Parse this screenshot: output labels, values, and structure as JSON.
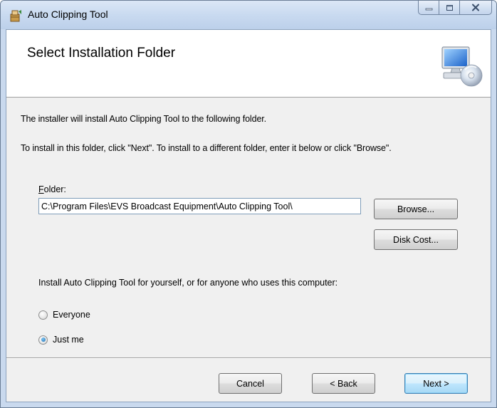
{
  "window": {
    "title": "Auto Clipping Tool"
  },
  "banner": {
    "title": "Select Installation Folder"
  },
  "body": {
    "line1": "The installer will install Auto Clipping Tool to the following folder.",
    "line2": "To install in this folder, click \"Next\". To install to a different folder, enter it below or click \"Browse\"."
  },
  "folder": {
    "label_accel": "F",
    "label_rest": "older:",
    "value": "C:\\Program Files\\EVS Broadcast Equipment\\Auto Clipping Tool\\"
  },
  "buttons": {
    "browse": "Browse...",
    "disk_cost": "Disk Cost...",
    "cancel": "Cancel",
    "back": "< Back",
    "next": "Next >"
  },
  "install_for": {
    "question": "Install Auto Clipping Tool for yourself, or for anyone who uses this computer:",
    "options": [
      {
        "label": "Everyone",
        "checked": false
      },
      {
        "label": "Just me",
        "checked": true
      }
    ]
  },
  "icons": {
    "app": "installer-icon",
    "banner": "computer-disc-icon"
  }
}
